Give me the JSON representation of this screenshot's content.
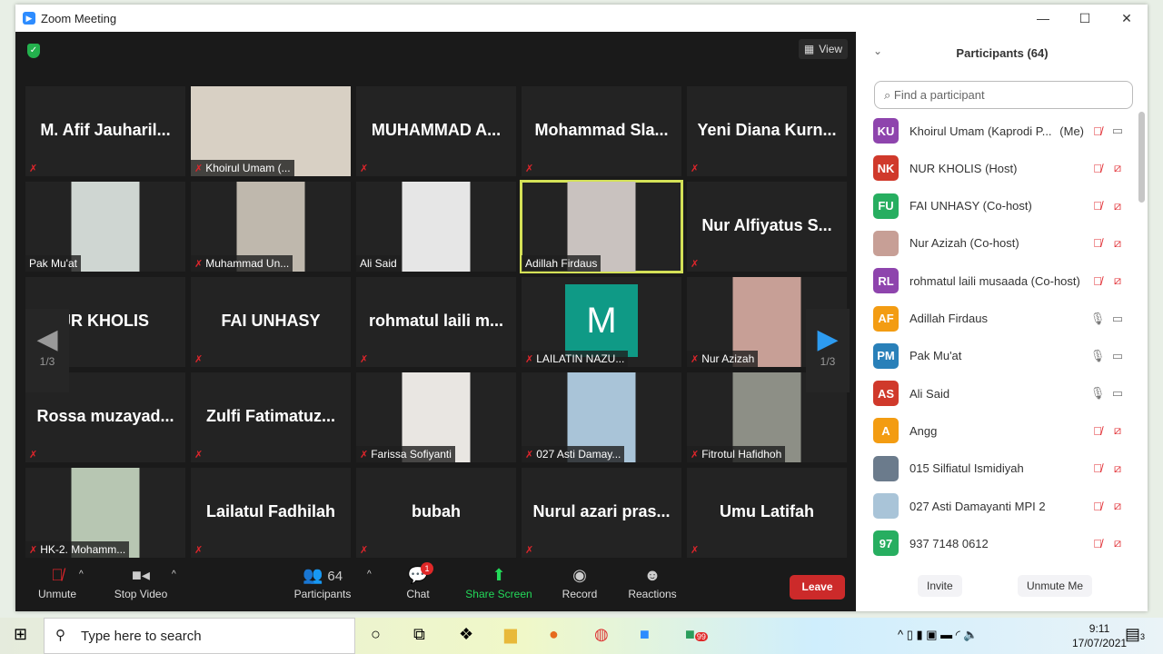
{
  "window": {
    "title": "Zoom Meeting",
    "controls": [
      "—",
      "☐",
      "✕"
    ]
  },
  "meeting": {
    "view_label": "View",
    "page_indicator": "1/3",
    "tiles": [
      {
        "name": "M. Afif Jauharil...",
        "video": false
      },
      {
        "name": "Khoirul Umam (...",
        "video": true,
        "color": "#d8d0c4"
      },
      {
        "name": "MUHAMMAD A...",
        "video": false
      },
      {
        "name": "Mohammad Sla...",
        "video": false
      },
      {
        "name": "Yeni Diana Kurn...",
        "video": false
      },
      {
        "name": "Pak Mu'at",
        "video": true,
        "color": "#cfd6d2",
        "unmuted": true
      },
      {
        "name": "Muhammad Un...",
        "video": true,
        "color": "#bfb8ad"
      },
      {
        "name": "Ali Said",
        "video": true,
        "color": "#e6e6e6",
        "unmuted": true
      },
      {
        "name": "Adillah Firdaus",
        "video": true,
        "color": "#c9c2bf",
        "unmuted": true,
        "active": true
      },
      {
        "name": "Nur Alfiyatus S...",
        "video": false
      },
      {
        "name": "JR KHOLIS",
        "video": false
      },
      {
        "name": "FAI UNHASY",
        "video": false
      },
      {
        "name": "rohmatul laili m...",
        "video": false
      },
      {
        "name": "LAILATIN NAZU...",
        "video": true,
        "avatar_letter": "M",
        "color": "#0f9a86"
      },
      {
        "name": "Nur Azizah",
        "video": true,
        "color": "#c79f96"
      },
      {
        "name": "Rossa muzayad...",
        "video": false
      },
      {
        "name": "Zulfi Fatimatuz...",
        "video": false
      },
      {
        "name": "Farissa Sofiyanti",
        "video": true,
        "color": "#e9e6e2"
      },
      {
        "name": "027 Asti Damay...",
        "video": true,
        "color": "#a9c4d8"
      },
      {
        "name": "Fitrotul Hafidhoh",
        "video": true,
        "color": "#8d8f86"
      },
      {
        "name": "HK-2. Mohamm...",
        "video": true,
        "color": "#b7c6b2"
      },
      {
        "name": "Lailatul Fadhilah",
        "video": false
      },
      {
        "name": "bubah",
        "video": false
      },
      {
        "name": "Nurul azari pras...",
        "video": false
      },
      {
        "name": "Umu Latifah",
        "video": false
      }
    ]
  },
  "toolbar": {
    "unmute": "Unmute",
    "stop_video": "Stop Video",
    "participants": "Participants",
    "participants_count": "64",
    "chat": "Chat",
    "chat_badge": "1",
    "share": "Share Screen",
    "record": "Record",
    "reactions": "Reactions",
    "leave": "Leave",
    "accent_share": "#23d959"
  },
  "panel": {
    "title": "Participants (64)",
    "search_placeholder": "Find a participant",
    "invite": "Invite",
    "unmute_me": "Unmute Me",
    "participants": [
      {
        "initials": "KU",
        "color": "#8e44ad",
        "name": "Khoirul Umam (Kaprodi P...",
        "me": "(Me)",
        "mic": "muted",
        "video": "on"
      },
      {
        "initials": "NK",
        "color": "#d0392b",
        "name": "NUR KHOLIS (Host)",
        "mic": "muted",
        "video": "off"
      },
      {
        "initials": "FU",
        "color": "#27ae60",
        "name": "FAI UNHASY (Co-host)",
        "mic": "muted",
        "video": "off"
      },
      {
        "initials": "",
        "color": "#c79f96",
        "photo": true,
        "name": "Nur Azizah (Co-host)",
        "mic": "muted",
        "video": "off"
      },
      {
        "initials": "RL",
        "color": "#8e44ad",
        "name": "rohmatul laili musaada (Co-host)",
        "mic": "muted",
        "video": "off"
      },
      {
        "initials": "AF",
        "color": "#f39c12",
        "name": "Adillah Firdaus",
        "mic": "on",
        "video": "on"
      },
      {
        "initials": "PM",
        "color": "#2980b9",
        "name": "Pak Mu'at",
        "mic": "on",
        "video": "on"
      },
      {
        "initials": "AS",
        "color": "#d0392b",
        "name": "Ali Said",
        "mic": "on",
        "video": "on"
      },
      {
        "initials": "A",
        "color": "#f39c12",
        "name": "Angg",
        "mic": "muted",
        "video": "off"
      },
      {
        "initials": "",
        "color": "#6b7b8c",
        "photo": true,
        "name": "015 Silfiatul Ismidiyah",
        "mic": "muted",
        "video": "off"
      },
      {
        "initials": "",
        "color": "#a9c4d8",
        "photo": true,
        "name": "027 Asti Damayanti MPI 2",
        "mic": "muted",
        "video": "off"
      },
      {
        "initials": "97",
        "color": "#27ae60",
        "name": "937 7148 0612",
        "mic": "muted",
        "video": "off"
      }
    ]
  },
  "taskbar": {
    "search_placeholder": "Type here to search",
    "time": "9:11",
    "date": "17/07/2021",
    "whatsapp_badge": "99",
    "notifications": "3"
  }
}
